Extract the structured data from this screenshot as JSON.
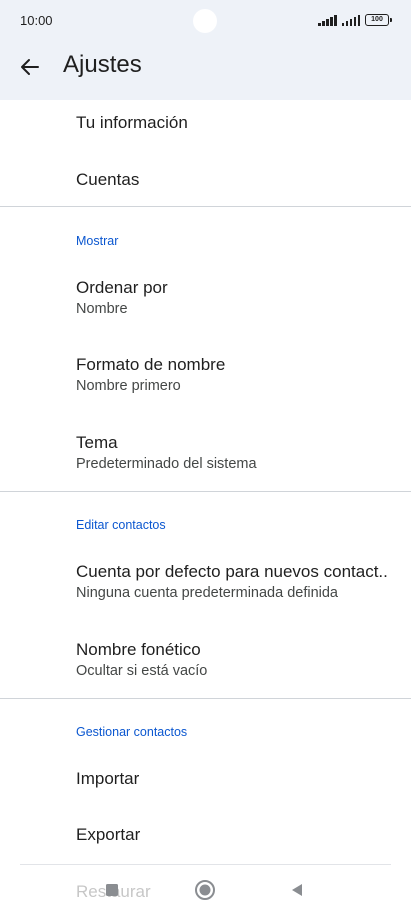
{
  "status_bar": {
    "time": "10:00",
    "battery": "100",
    "icons": [
      "signal-icon",
      "signal-icon",
      "battery-icon"
    ]
  },
  "app_bar": {
    "title": "Ajustes",
    "back_icon": "arrow-left-icon"
  },
  "list": {
    "tu_informacion": "Tu información",
    "cuentas": "Cuentas",
    "section_mostrar": "Mostrar",
    "ordenar_por": {
      "title": "Ordenar por",
      "value": "Nombre"
    },
    "formato_nombre": {
      "title": "Formato de nombre",
      "value": "Nombre primero"
    },
    "tema": {
      "title": "Tema",
      "value": "Predeterminado del sistema"
    },
    "section_editar": "Editar contactos",
    "cuenta_defecto": {
      "title": "Cuenta por defecto para nuevos contact..",
      "value": "Ninguna cuenta predeterminada definida"
    },
    "nombre_fonetico": {
      "title": "Nombre fonético",
      "value": "Ocultar si está vacío"
    },
    "section_gestionar": "Gestionar contactos",
    "importar": "Importar",
    "exportar": "Exportar",
    "restaurar": "Restaurar"
  },
  "nav_bar": {
    "icons": [
      "square-recents-icon",
      "circle-home-icon",
      "triangle-back-icon"
    ]
  },
  "colors": {
    "accent": "#0b57d0",
    "header_bg": "#eef2f8",
    "text": "#1f1f1f",
    "secondary_text": "#444746"
  }
}
